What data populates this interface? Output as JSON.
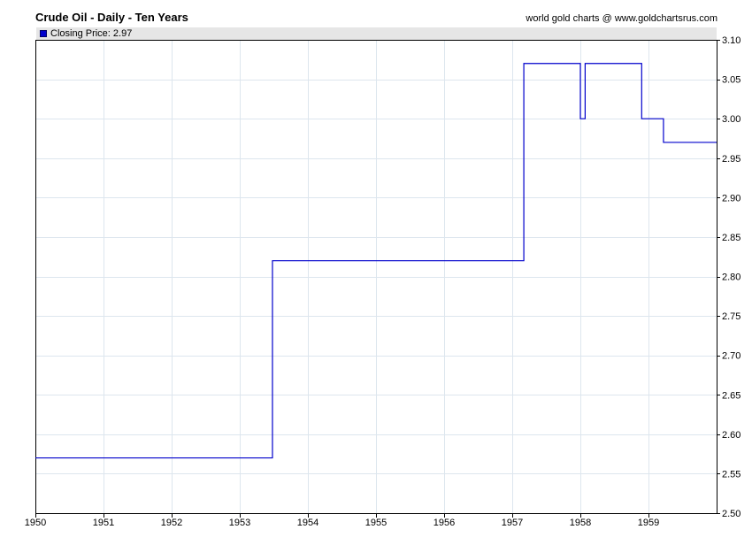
{
  "header": {
    "title": "Crude Oil - Daily - Ten Years",
    "credit": "world gold charts @ www.goldchartsrus.com"
  },
  "legend": {
    "label": "Closing Price: 2.97",
    "color": "#0000cc"
  },
  "chart_data": {
    "type": "line",
    "title": "Crude Oil - Daily - Ten Years",
    "xlabel": "",
    "ylabel": "",
    "series": [
      {
        "name": "Closing Price",
        "color": "#0000cc",
        "step": true,
        "x": [
          1950.0,
          1953.48,
          1957.17,
          1958.0,
          1958.07,
          1958.9,
          1959.22,
          1960.0
        ],
        "values": [
          2.57,
          2.82,
          3.07,
          3.0,
          3.07,
          3.0,
          2.97,
          2.97
        ]
      }
    ],
    "xlim": [
      1950,
      1960
    ],
    "ylim": [
      2.5,
      3.1
    ],
    "x_ticks": [
      "1950",
      "1951",
      "1952",
      "1953",
      "1954",
      "1955",
      "1956",
      "1957",
      "1958",
      "1959"
    ],
    "y_ticks": [
      "3.10",
      "3.05",
      "3.00",
      "2.95",
      "2.90",
      "2.85",
      "2.80",
      "2.75",
      "2.70",
      "2.65",
      "2.60",
      "2.55",
      "2.50"
    ],
    "y_axis_side": "right",
    "grid": true
  }
}
